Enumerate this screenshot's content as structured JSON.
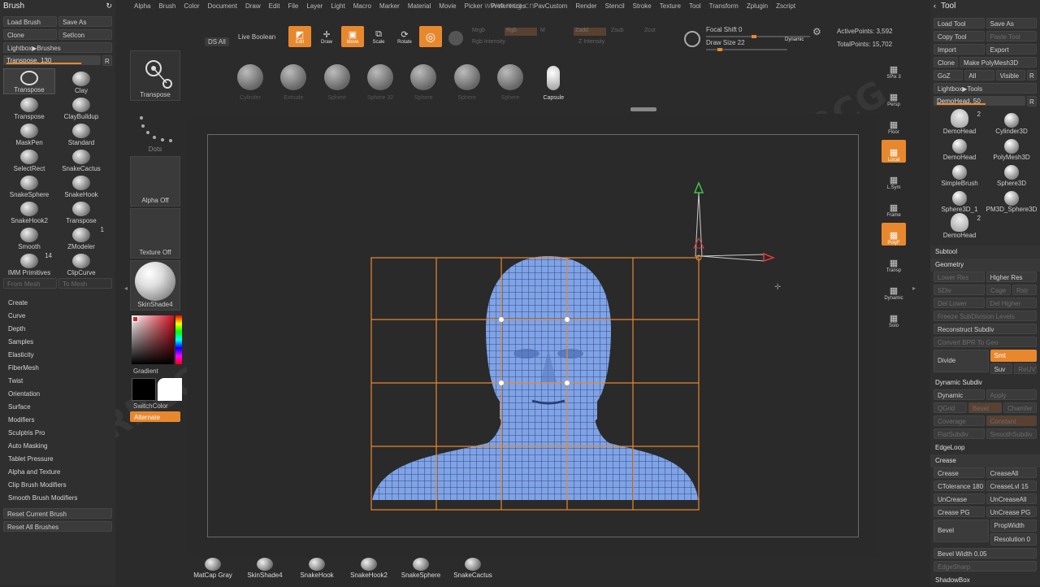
{
  "menu": [
    "Alpha",
    "Brush",
    "Color",
    "Document",
    "Draw",
    "Edit",
    "File",
    "Layer",
    "Light",
    "Macro",
    "Marker",
    "Material",
    "Movie",
    "Picker",
    "Preferences",
    "PavCustom",
    "Render",
    "Stencil",
    "Stroke",
    "Texture",
    "Tool",
    "Transform",
    "Zplugin",
    "Zscript"
  ],
  "watermark_url": "www.rrcg.cn",
  "brush_panel": {
    "title": "Brush",
    "load": "Load Brush",
    "saveas": "Save As",
    "clone": "Clone",
    "seticon": "SetIcon",
    "lightbox": "Lightbox▶Brushes",
    "transpose_slider": "Transpose. 130",
    "r": "R",
    "brushes": [
      {
        "name": "Transpose",
        "sel": true,
        "ring": true
      },
      {
        "name": "Clay"
      },
      {
        "name": "Transpose"
      },
      {
        "name": "ClayBuildup"
      },
      {
        "name": "MaskPen"
      },
      {
        "name": "Standard"
      },
      {
        "name": "SelectRect"
      },
      {
        "name": "SnakeCactus"
      },
      {
        "name": "SnakeSphere"
      },
      {
        "name": "SnakeHook"
      },
      {
        "name": "SnakeHook2"
      },
      {
        "name": "Transpose"
      },
      {
        "name": "Smooth"
      },
      {
        "name": "ZModeler",
        "badge": "1"
      },
      {
        "name": "IMM Primitives",
        "badge": "14"
      },
      {
        "name": "ClipCurve"
      }
    ],
    "from_mesh": "From Mesh",
    "to_mesh": "To Mesh",
    "sections": [
      "Create",
      "Curve",
      "Depth",
      "Samples",
      "Elasticity",
      "FiberMesh",
      "Twist",
      "Orientation",
      "Surface",
      "Modifiers",
      "Sculptris Pro",
      "Auto Masking",
      "Tablet Pressure",
      "Alpha and Texture",
      "Clip Brush Modifiers",
      "Smooth Brush Modifiers"
    ],
    "reset_current": "Reset Current Brush",
    "reset_all": "Reset All Brushes"
  },
  "col2": {
    "transpose": "Transpose",
    "dots": "Dots",
    "alpha": "Alpha Off",
    "texture": "Texture Off",
    "material": "SkinShade4",
    "gradient": "Gradient",
    "switch": "SwitchColor",
    "alternate": "Alternate"
  },
  "toolbar": {
    "ds_all": "DS All",
    "live_boolean": "Live Boolean",
    "edit": "Edit",
    "draw": "Draw",
    "move": "Move",
    "scale": "Scale",
    "rotate": "Rotate",
    "mrgb": "Mrgb",
    "rgb": "Rgb",
    "m": "M",
    "zadd": "Zadd",
    "zsub": "Zsub",
    "zcut": "Zcut",
    "rgb_intensity": "Rgb Intensity",
    "z_intensity": "Z Intensity",
    "focal_shift": "Focal Shift 0",
    "draw_size": "Draw Size 22",
    "dynamic": "Dynamic",
    "active_points": "ActivePoints: 3,592",
    "total_points": "TotalPoints: 15,702"
  },
  "shelf": [
    "Transpose",
    "Cylinder",
    "Extrude",
    "Sphere",
    "Sphere 32",
    "Sphere",
    "Sphere",
    "Sphere",
    "Capsule"
  ],
  "right_strip": [
    "SPix 3",
    "Persp",
    "Floor",
    "Local",
    "L.Sym",
    "Frame",
    "PolyF",
    "Transp",
    "Dynamic",
    "Solo"
  ],
  "tool_panel": {
    "title": "Tool",
    "load": "Load Tool",
    "saveas": "Save As",
    "copy": "Copy Tool",
    "paste": "Paste Tool",
    "import": "Import",
    "export": "Export",
    "clone": "Clone",
    "make_poly": "Make PolyMesh3D",
    "goz": "GoZ",
    "all": "All",
    "visible": "Visible",
    "r": "R",
    "lightbox": "Lightbox▶Tools",
    "demohead_slider": "DemoHead. 50",
    "tools": [
      {
        "name": "DemoHead",
        "badge": "2",
        "head": true
      },
      {
        "name": "Cylinder3D"
      },
      {
        "name": "DemoHead"
      },
      {
        "name": "PolyMesh3D"
      },
      {
        "name": "SimpleBrush"
      },
      {
        "name": "Sphere3D"
      },
      {
        "name": "Sphere3D_1"
      },
      {
        "name": "PM3D_Sphere3D"
      },
      {
        "name": "DemoHead",
        "badge": "2",
        "head": true
      }
    ],
    "subtool": "Subtool",
    "geometry": "Geometry",
    "lower_res": "Lower Res",
    "higher_res": "Higher Res",
    "sdiv": "SDiv",
    "cage": "Cage",
    "rstr": "Rstr",
    "del_lower": "Del Lower",
    "del_higher": "Del Higher",
    "freeze": "Freeze SubDivision Levels",
    "reconstruct": "Reconstruct Subdiv",
    "convert_bpr": "Convert BPR To Geo",
    "divide": "Divide",
    "smt": "Smt",
    "suv": "Suv",
    "reuv": "ReUV",
    "dynamic_subdiv": "Dynamic Subdiv",
    "dynamic": "Dynamic",
    "apply": "Apply",
    "qgrid": "QGrid",
    "bevel_btn": "Bevel",
    "chamfer": "Chamfer",
    "coverage": "Coverage",
    "constant": "Constant",
    "flatsubdiv": "FlatSubdiv",
    "smoothsubdiv": "SmoothSubdiv",
    "edgeloop": "EdgeLoop",
    "crease_section": "Crease",
    "crease": "Crease",
    "creaseall": "CreaseAll",
    "ctolerance": "CTolerance 180",
    "creaselvl": "CreaseLvl 15",
    "uncrease": "UnCrease",
    "uncreaseall": "UnCreaseAll",
    "creasepg": "Crease PG",
    "uncreasepg": "UnCrease PG",
    "bevel": "Bevel",
    "propwidth": "PropWidth",
    "resolution": "Resolution 0",
    "bevelwidth": "Bevel Width 0.05",
    "edgesharp": "EdgeSharp",
    "shadowbox": "ShadowBox"
  },
  "bottom": [
    "MatCap Gray",
    "SkinShade4",
    "SnakeHook",
    "SnakeHook2",
    "SnakeSphere",
    "SnakeCactus"
  ],
  "colors": {
    "accent": "#e8882e",
    "mesh": "#7fa3e6",
    "bg": "#2b2b2b",
    "gizmo_green": "#3ec24a",
    "gizmo_red": "#e03a3a"
  }
}
